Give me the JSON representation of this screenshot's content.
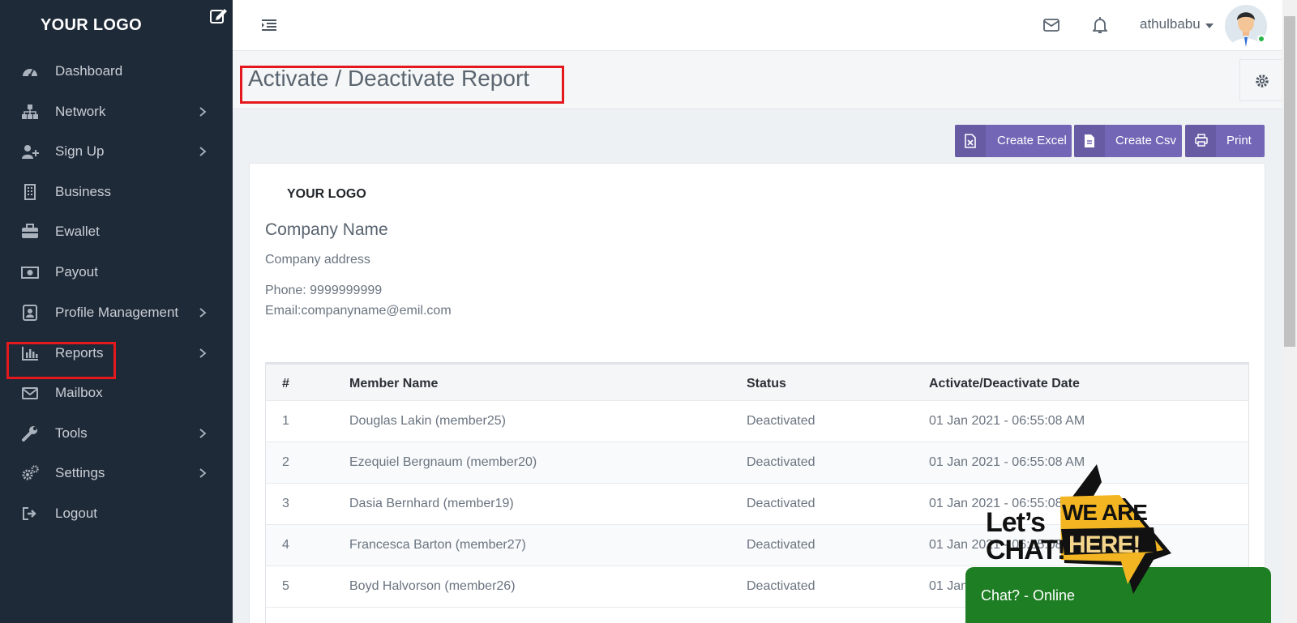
{
  "sidebar": {
    "logo": "YOUR LOGO",
    "items": [
      {
        "label": "Dashboard",
        "icon": "dashboard-icon",
        "has_submenu": false
      },
      {
        "label": "Network",
        "icon": "network-icon",
        "has_submenu": true
      },
      {
        "label": "Sign Up",
        "icon": "user-plus-icon",
        "has_submenu": true
      },
      {
        "label": "Business",
        "icon": "building-icon",
        "has_submenu": false
      },
      {
        "label": "Ewallet",
        "icon": "briefcase-icon",
        "has_submenu": false
      },
      {
        "label": "Payout",
        "icon": "money-icon",
        "has_submenu": false
      },
      {
        "label": "Profile Management",
        "icon": "address-book-icon",
        "has_submenu": true
      },
      {
        "label": "Reports",
        "icon": "bar-chart-icon",
        "has_submenu": true
      },
      {
        "label": "Mailbox",
        "icon": "envelope-icon",
        "has_submenu": false
      },
      {
        "label": "Tools",
        "icon": "wrench-icon",
        "has_submenu": true
      },
      {
        "label": "Settings",
        "icon": "gears-icon",
        "has_submenu": true
      },
      {
        "label": "Logout",
        "icon": "sign-out-icon",
        "has_submenu": false
      }
    ]
  },
  "topbar": {
    "username": "athulbabu"
  },
  "page": {
    "title": "Activate / Deactivate Report"
  },
  "actions": {
    "excel": "Create Excel",
    "csv": "Create Csv",
    "print": "Print"
  },
  "report": {
    "logo": "YOUR LOGO",
    "company_name": "Company Name",
    "address": "Company address",
    "phone": "Phone: 9999999999",
    "email": "Email:companyname@emil.com"
  },
  "table": {
    "columns": [
      "#",
      "Member Name",
      "Status",
      "Activate/Deactivate Date"
    ],
    "rows": [
      [
        "1",
        "Douglas Lakin (member25)",
        "Deactivated",
        "01 Jan 2021 - 06:55:08 AM"
      ],
      [
        "2",
        "Ezequiel Bergnaum (member20)",
        "Deactivated",
        "01 Jan 2021 - 06:55:08 AM"
      ],
      [
        "3",
        "Dasia Bernhard (member19)",
        "Deactivated",
        "01 Jan 2021 - 06:55:08 AM"
      ],
      [
        "4",
        "Francesca Barton (member27)",
        "Deactivated",
        "01 Jan 2021 - 06:55:08 AM"
      ],
      [
        "5",
        "Boyd Halvorson (member26)",
        "Deactivated",
        "01 Jan 2021 - 06:55:08 AM"
      ]
    ]
  },
  "chat": {
    "badge_line1": "Let’s",
    "badge_line2": "CHAT!",
    "badge_we_are": "WE ARE",
    "badge_here": "HERE!",
    "bar_label": "Chat? - Online"
  },
  "colors": {
    "sidebar_bg": "#1f2a38",
    "accent_button": "#7366b6",
    "highlight_box": "#e3191e",
    "chat_green": "#1e7e23",
    "chat_badge_yellow": "#f3b522"
  }
}
